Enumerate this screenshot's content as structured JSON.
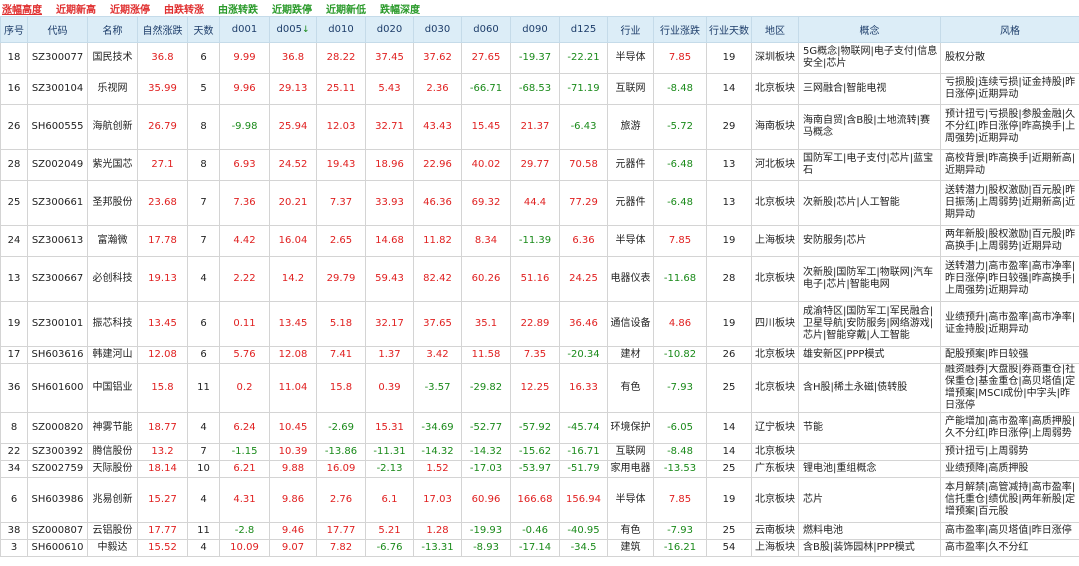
{
  "nav": [
    "涨幅高度",
    "近期新高",
    "近期涨停",
    "由跌转涨",
    "由涨转跌",
    "近期跌停",
    "近期新低",
    "跌幅深度"
  ],
  "headers": [
    "序号",
    "代码",
    "名称",
    "自然涨跌",
    "天数",
    "d001",
    "d005",
    "d010",
    "d020",
    "d030",
    "d060",
    "d090",
    "d125",
    "行业",
    "行业涨跌",
    "行业天数",
    "地区",
    "概念",
    "风格"
  ],
  "sort_arrow": "↓",
  "rows": [
    [
      "18",
      "SZ300077",
      "国民技术",
      "36.8",
      "6",
      "9.99",
      "36.8",
      "28.22",
      "37.45",
      "37.62",
      "27.65",
      "-19.37",
      "-22.21",
      "半导体",
      "7.85",
      "19",
      "深圳板块",
      "5G概念|物联网|电子支付|信息安全|芯片",
      "股权分散"
    ],
    [
      "16",
      "SZ300104",
      "乐视网",
      "35.99",
      "5",
      "9.96",
      "29.13",
      "25.11",
      "5.43",
      "2.36",
      "-66.71",
      "-68.53",
      "-71.19",
      "互联网",
      "-8.48",
      "14",
      "北京板块",
      "三网融合|智能电视",
      "亏损股|连续亏损|证金持股|昨日涨停|近期异动"
    ],
    [
      "26",
      "SH600555",
      "海航创新",
      "26.79",
      "8",
      "-9.98",
      "25.94",
      "12.03",
      "32.71",
      "43.43",
      "15.45",
      "21.37",
      "-6.43",
      "旅游",
      "-5.72",
      "29",
      "海南板块",
      "海南自贸|含B股|土地流转|赛马概念",
      "预计扭亏|亏损股|参股金融|久不分红|昨日涨停|昨高换手|上周强势|近期异动"
    ],
    [
      "28",
      "SZ002049",
      "紫光国芯",
      "27.1",
      "8",
      "6.93",
      "24.52",
      "19.43",
      "18.96",
      "22.96",
      "40.02",
      "29.77",
      "70.58",
      "元器件",
      "-6.48",
      "13",
      "河北板块",
      "国防军工|电子支付|芯片|蓝宝石",
      "高校背景|昨高换手|近期新高|近期异动"
    ],
    [
      "25",
      "SZ300661",
      "圣邦股份",
      "23.68",
      "7",
      "7.36",
      "20.21",
      "7.37",
      "33.93",
      "46.36",
      "69.32",
      "44.4",
      "77.29",
      "元器件",
      "-6.48",
      "13",
      "北京板块",
      "次新股|芯片|人工智能",
      "送转潜力|股权激励|百元股|昨日振荡|上周弱势|近期新高|近期异动"
    ],
    [
      "24",
      "SZ300613",
      "富瀚微",
      "17.78",
      "7",
      "4.42",
      "16.04",
      "2.65",
      "14.68",
      "11.82",
      "8.34",
      "-11.39",
      "6.36",
      "半导体",
      "7.85",
      "19",
      "上海板块",
      "安防服务|芯片",
      "两年新股|股权激励|百元股|昨高换手|上周弱势|近期异动"
    ],
    [
      "13",
      "SZ300667",
      "必创科技",
      "19.13",
      "4",
      "2.22",
      "14.2",
      "29.79",
      "59.43",
      "82.42",
      "60.26",
      "51.16",
      "24.25",
      "电器仪表",
      "-11.68",
      "28",
      "北京板块",
      "次新股|国防军工|物联网|汽车电子|芯片|智能电网",
      "送转潜力|高市盈率|高市净率|昨日涨停|昨日较强|昨高换手|上周强势|近期异动"
    ],
    [
      "19",
      "SZ300101",
      "振芯科技",
      "13.45",
      "6",
      "0.11",
      "13.45",
      "5.18",
      "32.17",
      "37.65",
      "35.1",
      "22.89",
      "36.46",
      "通信设备",
      "4.86",
      "19",
      "四川板块",
      "成渝特区|国防军工|军民融合|卫星导航|安防服务|网络游戏|芯片|智能穿戴|人工智能",
      "业绩预升|高市盈率|高市净率|证金持股|近期异动"
    ],
    [
      "17",
      "SH603616",
      "韩建河山",
      "12.08",
      "6",
      "5.76",
      "12.08",
      "7.41",
      "1.37",
      "3.42",
      "11.58",
      "7.35",
      "-20.34",
      "建材",
      "-10.82",
      "26",
      "北京板块",
      "雄安新区|PPP模式",
      "配股预案|昨日较强"
    ],
    [
      "36",
      "SH601600",
      "中国铝业",
      "15.8",
      "11",
      "0.2",
      "11.04",
      "15.8",
      "0.39",
      "-3.57",
      "-29.82",
      "12.25",
      "16.33",
      "有色",
      "-7.93",
      "25",
      "北京板块",
      "含H股|稀土永磁|债转股",
      "融资融券|大盘股|券商重仓|社保重仓|基金重仓|高贝塔值|定增预案|MSCI成份|中字头|昨日涨停"
    ],
    [
      "8",
      "SZ000820",
      "神雾节能",
      "18.77",
      "4",
      "6.24",
      "10.45",
      "-2.69",
      "15.31",
      "-34.69",
      "-52.77",
      "-57.92",
      "-45.74",
      "环境保护",
      "-6.05",
      "14",
      "辽宁板块",
      "节能",
      "产能增加|高市盈率|高质押股|久不分红|昨日涨停|上周弱势"
    ],
    [
      "22",
      "SZ300392",
      "腾信股份",
      "13.2",
      "7",
      "-1.15",
      "10.39",
      "-13.86",
      "-11.31",
      "-14.32",
      "-14.32",
      "-15.62",
      "-16.71",
      "互联网",
      "-8.48",
      "14",
      "北京板块",
      "",
      "预计扭亏|上周弱势"
    ],
    [
      "34",
      "SZ002759",
      "天际股份",
      "18.14",
      "10",
      "6.21",
      "9.88",
      "16.09",
      "-2.13",
      "1.52",
      "-17.03",
      "-53.97",
      "-51.79",
      "家用电器",
      "-13.53",
      "25",
      "广东板块",
      "锂电池|重组概念",
      "业绩预降|高质押股"
    ],
    [
      "6",
      "SH603986",
      "兆易创新",
      "15.27",
      "4",
      "4.31",
      "9.86",
      "2.76",
      "6.1",
      "17.03",
      "60.96",
      "166.68",
      "156.94",
      "半导体",
      "7.85",
      "19",
      "北京板块",
      "芯片",
      "本月解禁|高管减持|高市盈率|信托重仓|绩优股|两年新股|定增预案|百元股"
    ],
    [
      "38",
      "SZ000807",
      "云铝股份",
      "17.77",
      "11",
      "-2.8",
      "9.46",
      "17.77",
      "5.21",
      "1.28",
      "-19.93",
      "-0.46",
      "-40.95",
      "有色",
      "-7.93",
      "25",
      "云南板块",
      "燃料电池",
      "高市盈率|高贝塔值|昨日涨停"
    ],
    [
      "3",
      "SH600610",
      "中毅达",
      "15.52",
      "4",
      "10.09",
      "9.07",
      "7.82",
      "-6.76",
      "-13.31",
      "-8.93",
      "-17.14",
      "-34.5",
      "建筑",
      "-16.21",
      "54",
      "上海板块",
      "含B股|装饰园林|PPP模式",
      "高市盈率|久不分红"
    ]
  ]
}
